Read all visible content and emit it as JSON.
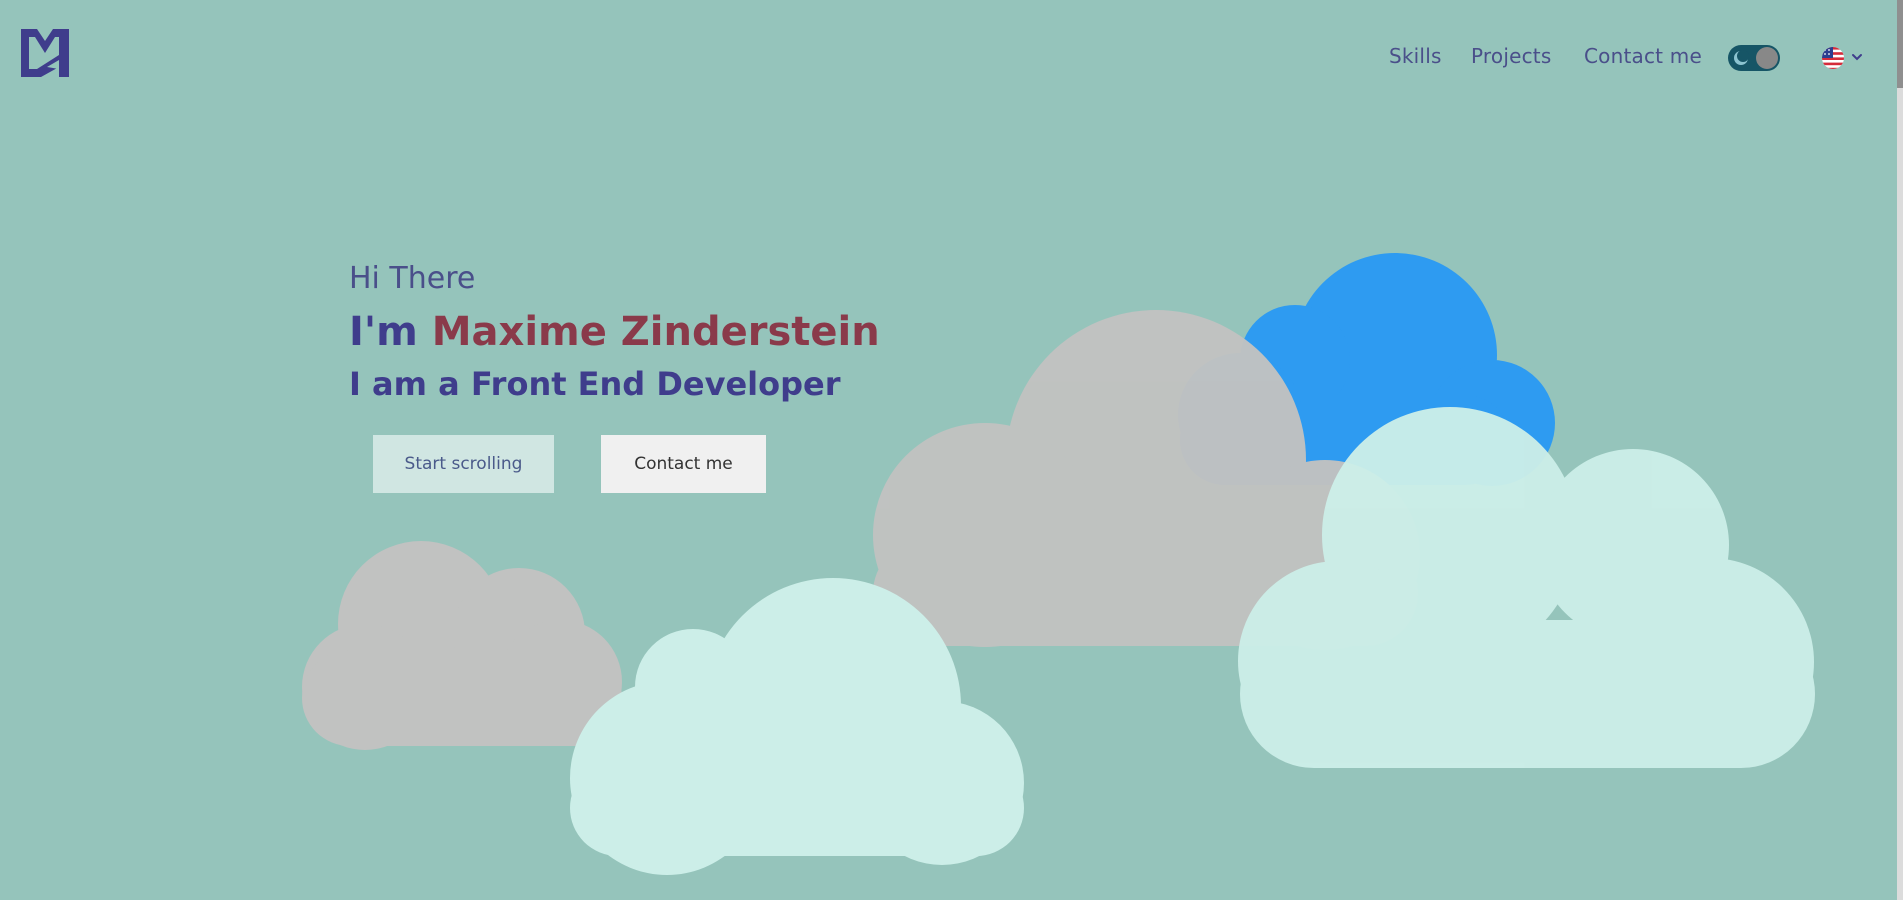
{
  "header": {
    "logo_name": "MZ monogram logo",
    "nav": [
      {
        "label": "Skills"
      },
      {
        "label": "Projects"
      },
      {
        "label": "Contact me"
      }
    ],
    "theme_toggle": {
      "state": "dark-mode-off",
      "icon": "moon-icon"
    },
    "language": {
      "flag": "us-flag-icon",
      "icon": "chevron-down-icon"
    }
  },
  "hero": {
    "greeting": "Hi There",
    "im_prefix": "I'm",
    "name": "Maxime Zinderstein",
    "role": "I am a Front End Developer",
    "buttons": {
      "start_scrolling": "Start scrolling",
      "contact_me": "Contact me"
    }
  },
  "colors": {
    "background": "#95c4bb",
    "nav_text": "#4a4f8a",
    "name_accent": "#8a3a4a",
    "heading": "#3f3d8c",
    "cloud_grey": "#c1c2c1",
    "cloud_mint": "#cceee8",
    "cloud_blue": "#2e9bf1"
  }
}
